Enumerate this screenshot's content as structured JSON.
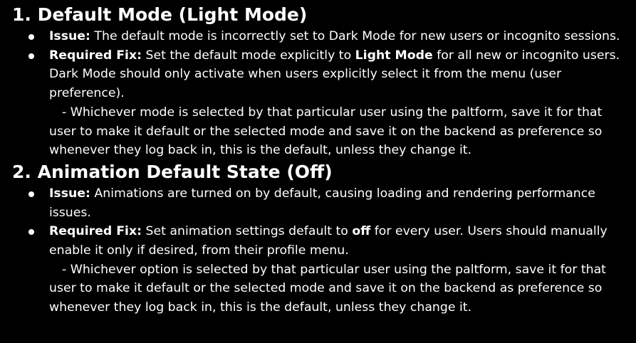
{
  "sections": [
    {
      "heading": "1. Default Mode (Light Mode)",
      "issue": {
        "label": "Issue:",
        "text": " The default mode is incorrectly set to Dark Mode for new users or incognito sessions."
      },
      "fix": {
        "label": "Required Fix:",
        "text_before": " Set the default mode explicitly to ",
        "emphasis": "Light Mode",
        "text_after": " for all new or incognito users. Dark Mode should only activate when users explicitly select it from the menu (user preference).",
        "note": "- Whichever mode is selected by that particular user using the paltform, save it for that user to make it default or the selected mode and save it on the backend as preference so whenever they log back in, this is the default, unless they change it."
      }
    },
    {
      "heading": "2. Animation Default State (Off)",
      "issue": {
        "label": "Issue:",
        "text": " Animations are turned on by default, causing loading and rendering performance issues."
      },
      "fix": {
        "label": "Required Fix:",
        "text_before": " Set animation settings default to ",
        "emphasis": "off",
        "text_after": " for every user. Users should manually enable it only if desired, from their profile menu.",
        "note": "- Whichever option is selected by that particular user using the paltform, save it for that user to make it default or the selected mode and save it on the backend as preference so whenever they log back in, this is the default, unless they change it."
      }
    }
  ]
}
